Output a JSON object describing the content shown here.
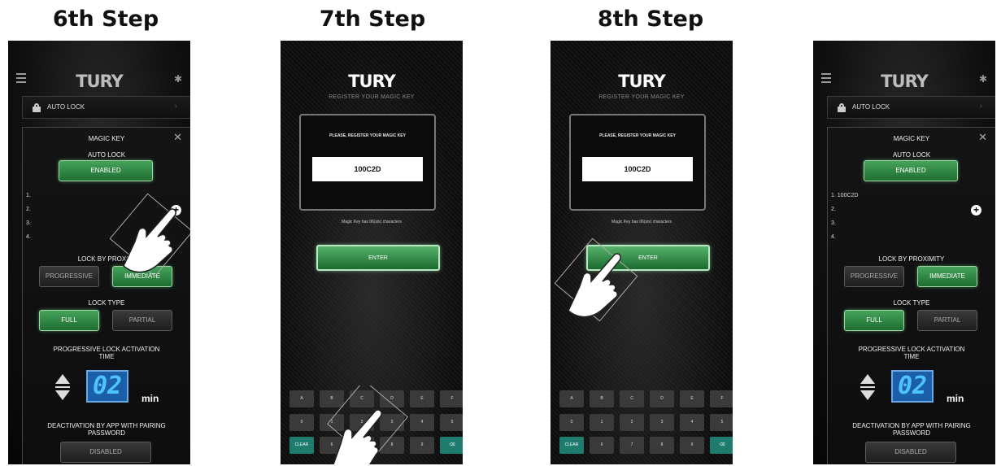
{
  "steps": [
    {
      "title": "6th Step"
    },
    {
      "title": "7th Step"
    },
    {
      "title": "8th Step"
    },
    {
      "title": ""
    }
  ],
  "app": {
    "logo": "TURY",
    "bluetooth_icon": "bluetooth-icon",
    "menu_icon": "hamburger-icon"
  },
  "autolock_bar": {
    "label": "AUTO LOCK",
    "icon": "lock-icon",
    "chevron": "›"
  },
  "magic_panel": {
    "title": "MAGIC KEY",
    "close": "✕",
    "auto_lock_label": "AUTO LOCK",
    "enabled_label": "ENABLED",
    "slots_6": [
      "1.",
      "2.",
      "3.",
      "4."
    ],
    "slots_final": [
      "1. 100C2D",
      "2.",
      "3.",
      "4."
    ],
    "add_icon": "+",
    "proximity_label_6": "LOCK BY PROXIMI",
    "proximity_label": "LOCK BY PROXIMITY",
    "progressive_label": "PROGRESSIVE",
    "immediate_label_6": "IMMEDIATE",
    "immediate_label": "IMMEDIATE",
    "lock_type_label": "LOCK TYPE",
    "full_label": "FULL",
    "partial_label": "PARTIAL",
    "activation_label_1": "PROGRESSIVE LOCK ACTIVATION",
    "activation_label_2": "TIME",
    "time_value": "02",
    "time_unit": "min",
    "deactivation_label_1": "DEACTIVATION BY APP WITH PAIRING",
    "deactivation_label_2": "PASSWORD",
    "disabled_label": "DISABLED"
  },
  "register": {
    "subtitle": "REGISTER YOUR MAGIC KEY",
    "prompt": "PLEASE, REGISTER YOUR MAGIC KEY",
    "key_value": "100C2D",
    "hint": "Magic Key has 06(six) characters",
    "enter_label": "ENTER"
  },
  "keyboard": {
    "row1": [
      "A",
      "B",
      "C",
      "D",
      "E",
      "F"
    ],
    "row2": [
      "0",
      "1",
      "2",
      "3",
      "4",
      "5"
    ],
    "row3": [
      "CLEAR",
      "6",
      "7",
      "8",
      "9",
      "⌫"
    ]
  },
  "colors": {
    "green": "#2e8a44",
    "digit_bg": "#1a5fa8",
    "teal": "#1d7c6d"
  }
}
